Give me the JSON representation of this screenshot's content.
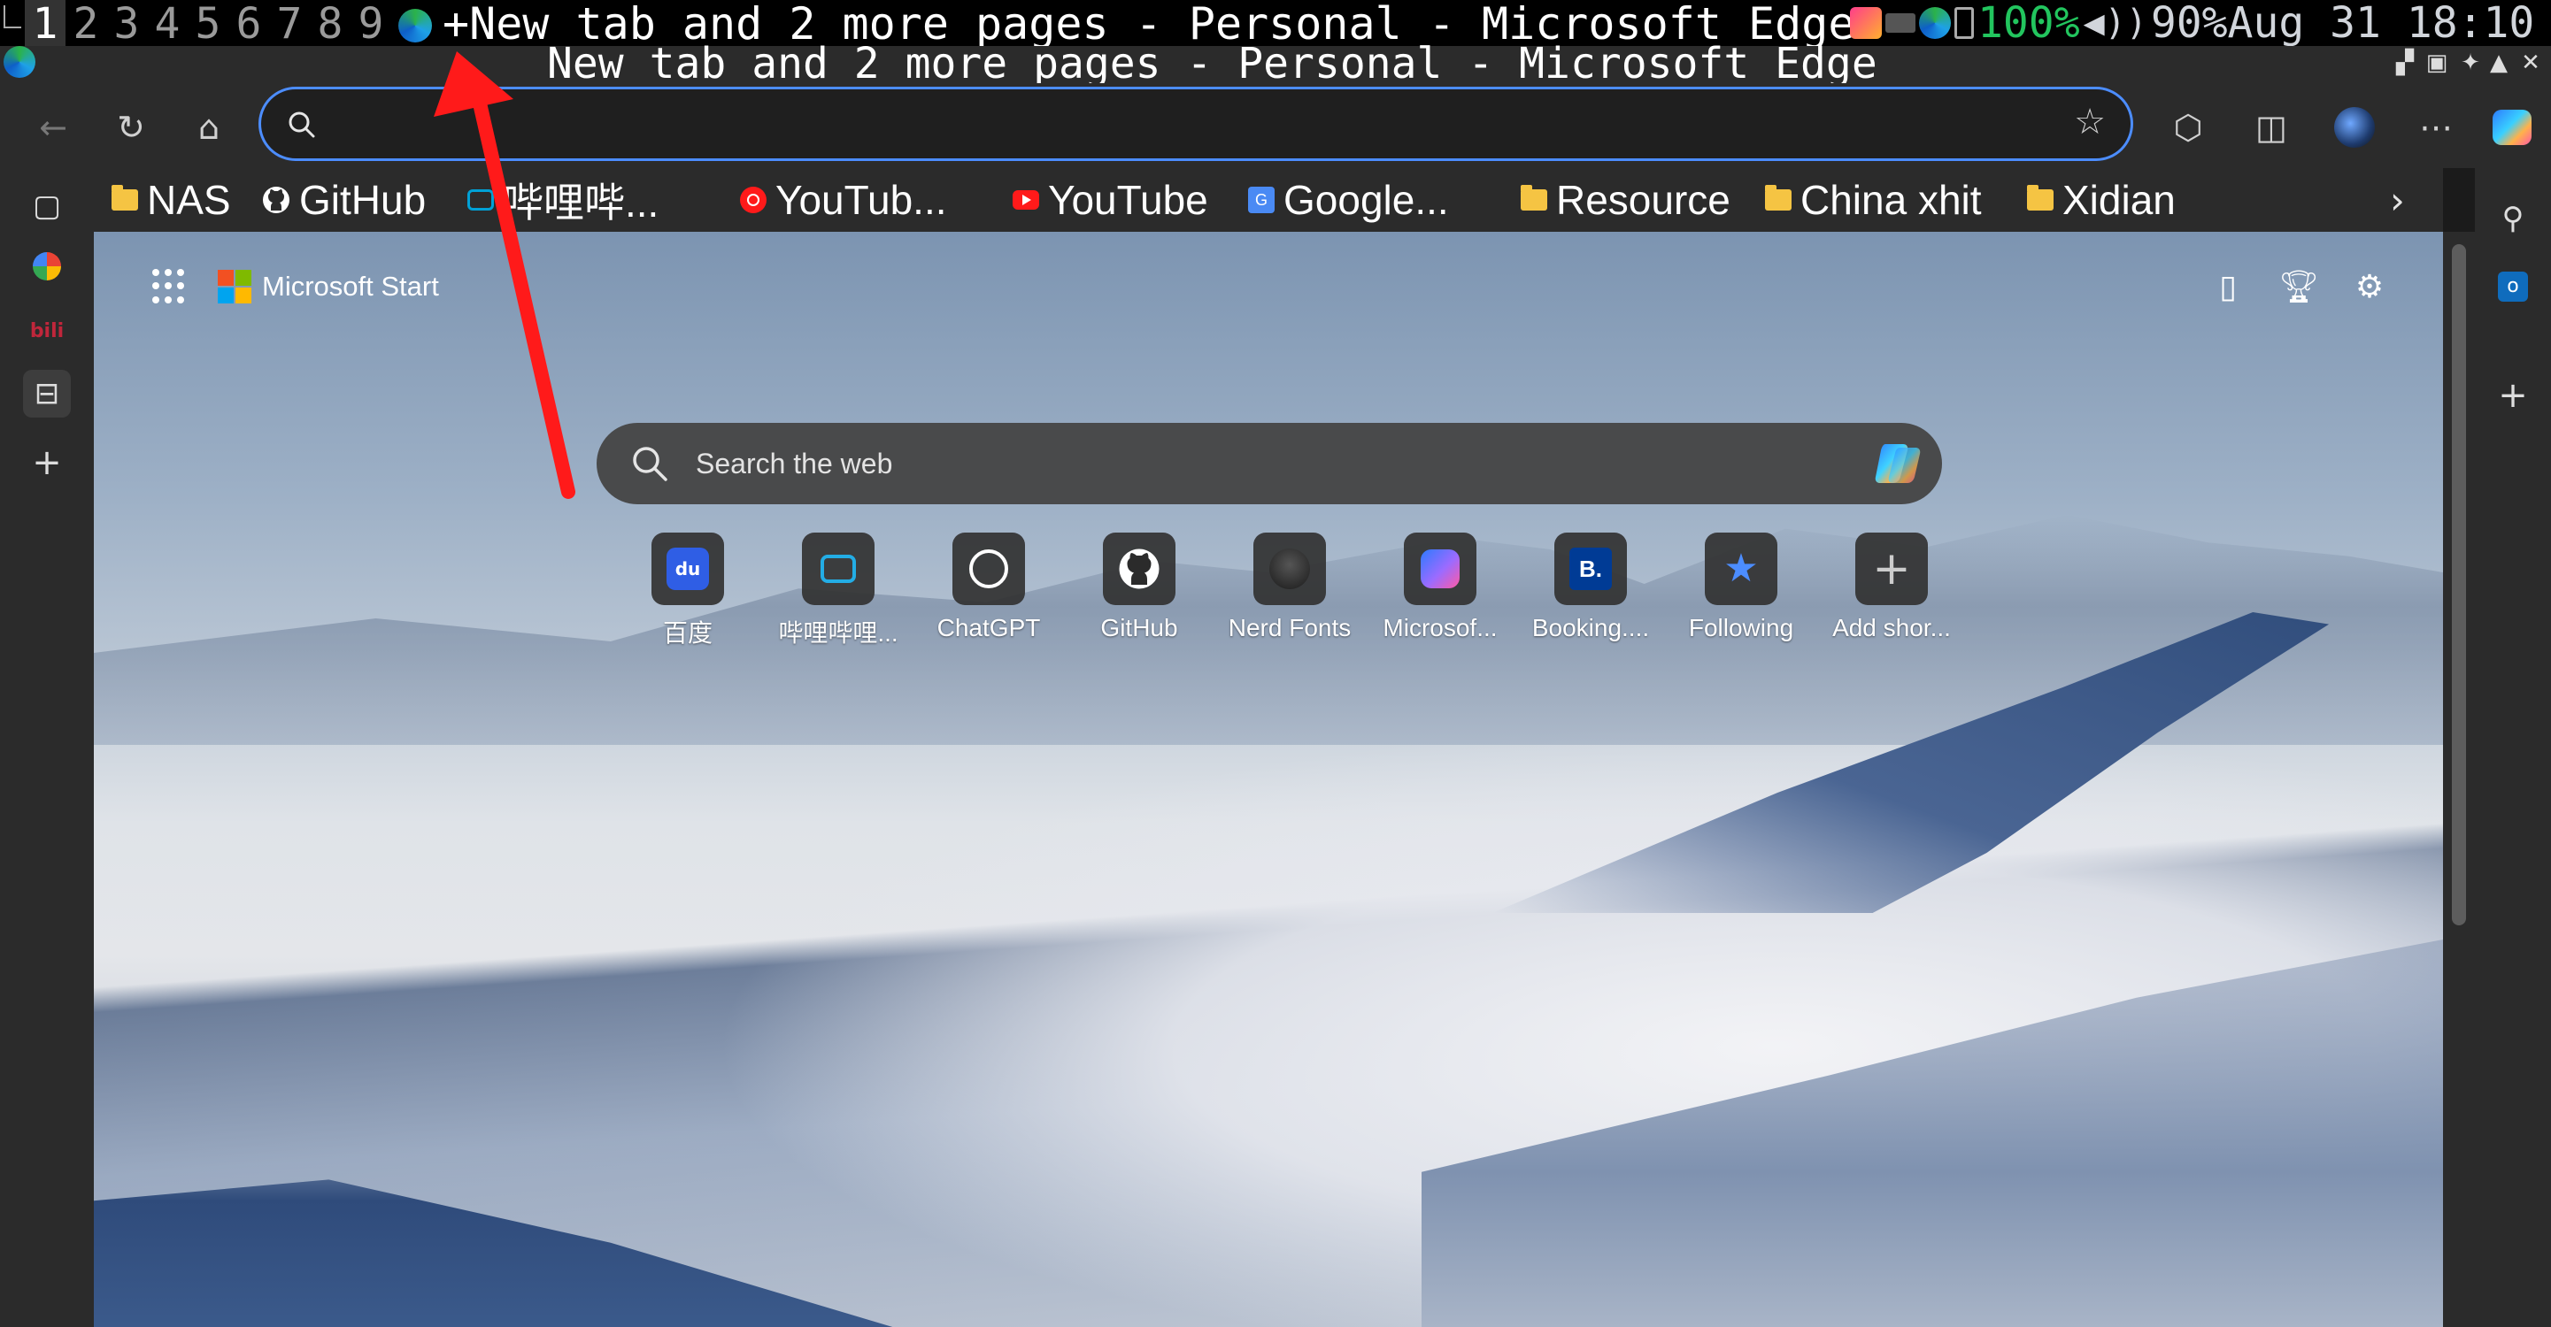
{
  "wm_bar": {
    "workspaces": [
      "1",
      "2",
      "3",
      "4",
      "5",
      "6",
      "7",
      "8",
      "9"
    ],
    "active_workspace": "1",
    "window_title": "+New tab and 2 more pages - Personal - Microsoft Edge",
    "battery": "100%",
    "volume": "90%",
    "datetime": "Aug 31 18:10"
  },
  "browser": {
    "window_title": "New tab and 2 more pages - Personal - Microsoft Edge",
    "address_value": ""
  },
  "bookmarks": [
    {
      "label": "NAS",
      "icon": "folder-icon"
    },
    {
      "label": "GitHub",
      "icon": "github-icon"
    },
    {
      "label": "哔哩哔...",
      "icon": "bilibili-icon"
    },
    {
      "label": "YouTub...",
      "icon": "youtube-music-icon"
    },
    {
      "label": "YouTube",
      "icon": "youtube-icon"
    },
    {
      "label": "Google...",
      "icon": "google-translate-icon"
    },
    {
      "label": "Resource",
      "icon": "folder-icon"
    },
    {
      "label": "China xhit",
      "icon": "folder-icon"
    },
    {
      "label": "Xidian",
      "icon": "folder-icon"
    }
  ],
  "newtab": {
    "brand": "Microsoft Start",
    "search_placeholder": "Search the web",
    "shortcuts": [
      {
        "label": "百度",
        "icon": "baidu-icon"
      },
      {
        "label": "哔哩哔哩...",
        "icon": "bilibili-icon"
      },
      {
        "label": "ChatGPT",
        "icon": "chatgpt-icon"
      },
      {
        "label": "GitHub",
        "icon": "github-icon"
      },
      {
        "label": "Nerd Fonts",
        "icon": "nerd-fonts-icon"
      },
      {
        "label": "Microsof...",
        "icon": "microsoft-copilot-icon"
      },
      {
        "label": "Booking....",
        "icon": "booking-icon"
      },
      {
        "label": "Following",
        "icon": "following-icon"
      },
      {
        "label": "Add shor...",
        "icon": "plus-icon"
      }
    ]
  },
  "colors": {
    "accent": "#4c8dff",
    "battery": "#22c55e",
    "arrow": "#ff1a1a"
  }
}
